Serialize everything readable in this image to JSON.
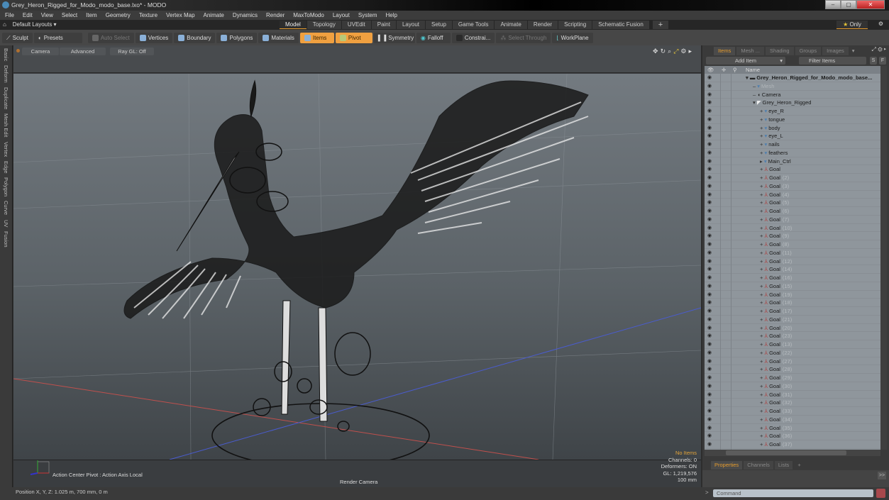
{
  "window": {
    "title": "Grey_Heron_Rigged_for_Modo_modo_base.lxo* - MODO",
    "controls": [
      "minimize",
      "restore",
      "close"
    ]
  },
  "menu": [
    "File",
    "Edit",
    "View",
    "Select",
    "Item",
    "Geometry",
    "Texture",
    "Vertex Map",
    "Animate",
    "Dynamics",
    "Render",
    "MaxToModo",
    "Layout",
    "System",
    "Help"
  ],
  "layout_bar": {
    "layouts_label": "Default Layouts",
    "tabs": [
      "Model",
      "Topology",
      "UVEdit",
      "Paint",
      "Layout",
      "Setup",
      "Game Tools",
      "Animate",
      "Render",
      "Scripting",
      "Schematic Fusion"
    ],
    "active_tab": "Model",
    "only_label": "Only"
  },
  "toolbar": {
    "sculpt": "Sculpt",
    "presets": "Presets",
    "auto_select": "Auto Select",
    "vertices": "Vertices",
    "boundary": "Boundary",
    "polygons": "Polygons",
    "materials": "Materials",
    "items": "Items",
    "pivot": "Pivot",
    "symmetry": "Symmetry",
    "falloff": "Falloff",
    "constraints": "Constrai...",
    "select_through": "Select Through",
    "workplane": "WorkPlane"
  },
  "left_tabs": [
    "Basic",
    "Deform",
    "Duplicate",
    "Mesh Edit",
    "Vertex",
    "Edge",
    "Polygon",
    "Curve",
    "UV",
    "Fusion"
  ],
  "viewport": {
    "buttons": [
      "Camera",
      "Advanced",
      "Ray GL: Off"
    ],
    "action_center": "Action Center Pivot : Action Axis Local",
    "camera_label": "Render Camera",
    "stats": {
      "selection": "No Items",
      "channels": "Channels: 0",
      "deformers": "Deformers: ON",
      "gl": "GL: 1,219,576",
      "unit": "100 mm"
    }
  },
  "status": {
    "position": "Position X, Y, Z:   1.025 m, 700 mm, 0 m"
  },
  "items_panel": {
    "tabs": [
      "Items",
      "Mesh ...",
      "Shading",
      "Groups",
      "Images"
    ],
    "active_tab": "Items",
    "add_item": "Add Item",
    "filter_placeholder": "Filter Items",
    "s_label": "S",
    "f_label": "F",
    "column_name": "Name",
    "rows": [
      {
        "label": "Grey_Heron_Rigged_for_Modo_modo_base...",
        "num": "",
        "indent": 0,
        "style": "bold",
        "icon": "scene-icon"
      },
      {
        "label": "Mesh",
        "num": "",
        "indent": 1,
        "style": "dim",
        "icon": "mesh-icon"
      },
      {
        "label": "Camera",
        "num": "",
        "indent": 1,
        "style": "",
        "icon": "camera-icon"
      },
      {
        "label": "Grey_Heron_Rigged",
        "num": "",
        "indent": 1,
        "style": "",
        "icon": "locator-icon"
      },
      {
        "label": "eye_R",
        "num": "",
        "indent": 2,
        "style": "",
        "icon": "mesh-icon"
      },
      {
        "label": "tongue",
        "num": "",
        "indent": 2,
        "style": "",
        "icon": "mesh-icon"
      },
      {
        "label": "body",
        "num": "",
        "indent": 2,
        "style": "",
        "icon": "mesh-icon"
      },
      {
        "label": "eye_L",
        "num": "",
        "indent": 2,
        "style": "",
        "icon": "mesh-icon"
      },
      {
        "label": "nails",
        "num": "",
        "indent": 2,
        "style": "",
        "icon": "mesh-icon"
      },
      {
        "label": "feathers",
        "num": "",
        "indent": 2,
        "style": "",
        "icon": "mesh-icon"
      },
      {
        "label": "Main_Ctrl",
        "num": "",
        "indent": 2,
        "style": "",
        "icon": "mesh-icon"
      },
      {
        "label": "Goal",
        "num": "",
        "indent": 2,
        "style": "",
        "icon": "goal-icon"
      },
      {
        "label": "Goal",
        "num": "(2)",
        "indent": 2,
        "style": "",
        "icon": "goal-icon"
      },
      {
        "label": "Goal",
        "num": "(3)",
        "indent": 2,
        "style": "",
        "icon": "goal-icon"
      },
      {
        "label": "Goal",
        "num": "(4)",
        "indent": 2,
        "style": "",
        "icon": "goal-icon"
      },
      {
        "label": "Goal",
        "num": "(5)",
        "indent": 2,
        "style": "",
        "icon": "goal-icon"
      },
      {
        "label": "Goal",
        "num": "(6)",
        "indent": 2,
        "style": "",
        "icon": "goal-icon"
      },
      {
        "label": "Goal",
        "num": "(7)",
        "indent": 2,
        "style": "",
        "icon": "goal-icon"
      },
      {
        "label": "Goal",
        "num": "(10)",
        "indent": 2,
        "style": "",
        "icon": "goal-icon"
      },
      {
        "label": "Goal",
        "num": "(9)",
        "indent": 2,
        "style": "",
        "icon": "goal-icon"
      },
      {
        "label": "Goal",
        "num": "(8)",
        "indent": 2,
        "style": "",
        "icon": "goal-icon"
      },
      {
        "label": "Goal",
        "num": "(11)",
        "indent": 2,
        "style": "",
        "icon": "goal-icon"
      },
      {
        "label": "Goal",
        "num": "(12)",
        "indent": 2,
        "style": "",
        "icon": "goal-icon"
      },
      {
        "label": "Goal",
        "num": "(14)",
        "indent": 2,
        "style": "",
        "icon": "goal-icon"
      },
      {
        "label": "Goal",
        "num": "(16)",
        "indent": 2,
        "style": "",
        "icon": "goal-icon"
      },
      {
        "label": "Goal",
        "num": "(15)",
        "indent": 2,
        "style": "",
        "icon": "goal-icon"
      },
      {
        "label": "Goal",
        "num": "(19)",
        "indent": 2,
        "style": "",
        "icon": "goal-icon"
      },
      {
        "label": "Goal",
        "num": "(18)",
        "indent": 2,
        "style": "",
        "icon": "goal-icon"
      },
      {
        "label": "Goal",
        "num": "(17)",
        "indent": 2,
        "style": "",
        "icon": "goal-icon"
      },
      {
        "label": "Goal",
        "num": "(21)",
        "indent": 2,
        "style": "",
        "icon": "goal-icon"
      },
      {
        "label": "Goal",
        "num": "(20)",
        "indent": 2,
        "style": "",
        "icon": "goal-icon"
      },
      {
        "label": "Goal",
        "num": "(23)",
        "indent": 2,
        "style": "",
        "icon": "goal-icon"
      },
      {
        "label": "Goal",
        "num": "(13)",
        "indent": 2,
        "style": "",
        "icon": "goal-icon"
      },
      {
        "label": "Goal",
        "num": "(22)",
        "indent": 2,
        "style": "",
        "icon": "goal-icon"
      },
      {
        "label": "Goal",
        "num": "(27)",
        "indent": 2,
        "style": "",
        "icon": "goal-icon"
      },
      {
        "label": "Goal",
        "num": "(28)",
        "indent": 2,
        "style": "",
        "icon": "goal-icon"
      },
      {
        "label": "Goal",
        "num": "(29)",
        "indent": 2,
        "style": "",
        "icon": "goal-icon"
      },
      {
        "label": "Goal",
        "num": "(30)",
        "indent": 2,
        "style": "",
        "icon": "goal-icon"
      },
      {
        "label": "Goal",
        "num": "(31)",
        "indent": 2,
        "style": "",
        "icon": "goal-icon"
      },
      {
        "label": "Goal",
        "num": "(32)",
        "indent": 2,
        "style": "",
        "icon": "goal-icon"
      },
      {
        "label": "Goal",
        "num": "(33)",
        "indent": 2,
        "style": "",
        "icon": "goal-icon"
      },
      {
        "label": "Goal",
        "num": "(34)",
        "indent": 2,
        "style": "",
        "icon": "goal-icon"
      },
      {
        "label": "Goal",
        "num": "(35)",
        "indent": 2,
        "style": "",
        "icon": "goal-icon"
      },
      {
        "label": "Goal",
        "num": "(36)",
        "indent": 2,
        "style": "",
        "icon": "goal-icon"
      },
      {
        "label": "Goal",
        "num": "(37)",
        "indent": 2,
        "style": "",
        "icon": "goal-icon"
      }
    ]
  },
  "properties_panel": {
    "tabs": [
      "Properties",
      "Channels",
      "Lists"
    ],
    "active_tab": "Properties",
    "more_label": ">>",
    "command_placeholder": "Command"
  },
  "colors": {
    "accent": "#e59b2d",
    "active_tool": "#f0a040",
    "x_axis": "#c0504d",
    "z_axis": "#4a5ccf"
  }
}
